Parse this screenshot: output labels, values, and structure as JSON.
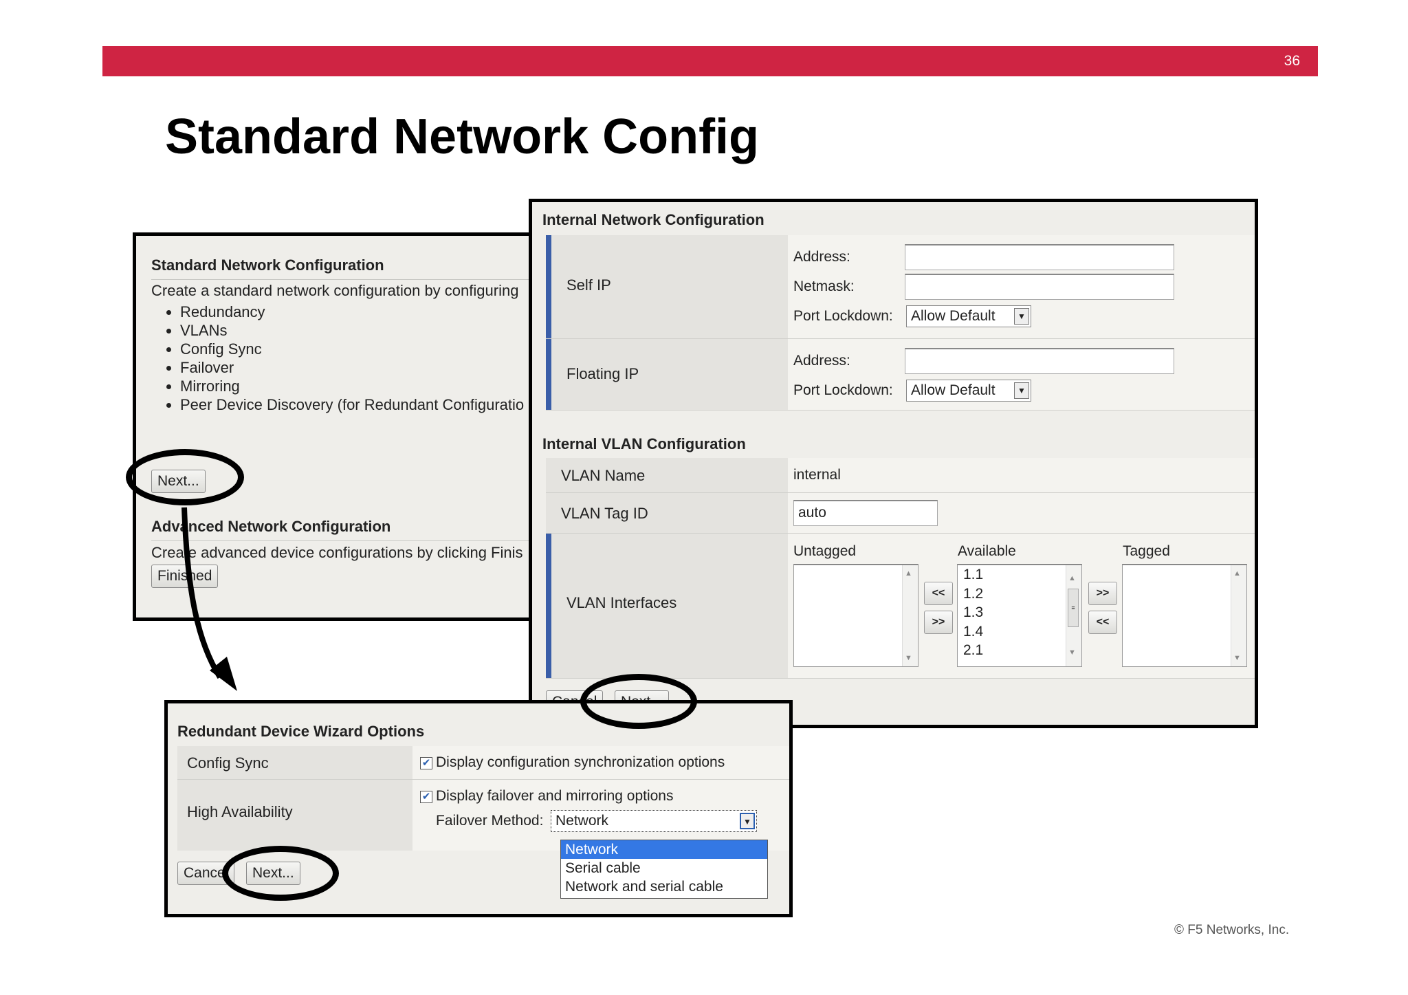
{
  "slide": {
    "page_number": "36",
    "title": "Standard Network Config",
    "copyright": "© F5 Networks, Inc."
  },
  "standard_panel": {
    "heading": "Standard Network Configuration",
    "description": "Create a standard network configuration by configuring",
    "features": [
      "Redundancy",
      "VLANs",
      "Config Sync",
      "Failover",
      "Mirroring",
      "Peer Device Discovery (for Redundant Configuratio"
    ],
    "next_button": "Next...",
    "advanced_heading": "Advanced Network Configuration",
    "advanced_description": "Create advanced device configurations by clicking Finis",
    "finished_button": "Finished"
  },
  "internal_panel": {
    "heading": "Internal Network Configuration",
    "self_ip": {
      "label": "Self IP",
      "address_label": "Address:",
      "address_value": "",
      "netmask_label": "Netmask:",
      "netmask_value": "",
      "port_lockdown_label": "Port Lockdown:",
      "port_lockdown_value": "Allow Default"
    },
    "floating_ip": {
      "label": "Floating IP",
      "address_label": "Address:",
      "address_value": "",
      "port_lockdown_label": "Port Lockdown:",
      "port_lockdown_value": "Allow Default"
    },
    "vlan_heading": "Internal VLAN Configuration",
    "vlan_name_label": "VLAN Name",
    "vlan_name_value": "internal",
    "vlan_tag_label": "VLAN Tag ID",
    "vlan_tag_value": "auto",
    "vlan_interfaces_label": "VLAN Interfaces",
    "untagged_label": "Untagged",
    "available_label": "Available",
    "tagged_label": "Tagged",
    "available_items": [
      "1.1",
      "1.2",
      "1.3",
      "1.4",
      "2.1"
    ],
    "move_left": "<<",
    "move_right": ">>",
    "cancel_button": "Cancel",
    "next_button": "Next..."
  },
  "redundant_panel": {
    "heading": "Redundant Device Wizard Options",
    "config_sync_label": "Config Sync",
    "config_sync_option": "Display configuration synchronization options",
    "config_sync_checked": true,
    "ha_label": "High Availability",
    "ha_option": "Display failover and mirroring options",
    "ha_checked": true,
    "failover_method_label": "Failover Method:",
    "failover_method_value": "Network",
    "failover_options": [
      "Network",
      "Serial cable",
      "Network and serial cable"
    ],
    "cancel_button": "Cancel",
    "next_button": "Next..."
  }
}
